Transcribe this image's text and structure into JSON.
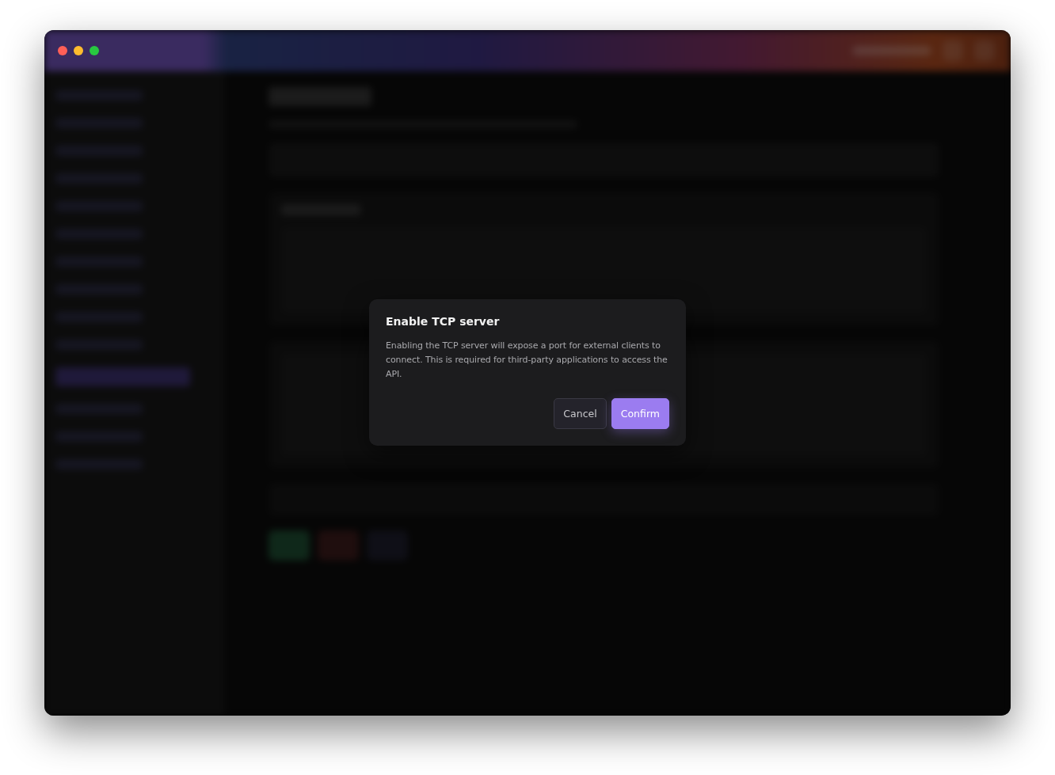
{
  "sidebar": {
    "items": [
      {
        "selected": false
      },
      {
        "selected": false
      },
      {
        "selected": false
      },
      {
        "selected": false
      },
      {
        "selected": false
      },
      {
        "selected": false
      },
      {
        "selected": false
      },
      {
        "selected": false
      },
      {
        "selected": false
      },
      {
        "selected": false
      },
      {
        "selected": true
      },
      {
        "selected": false
      },
      {
        "selected": false
      },
      {
        "selected": false
      }
    ]
  },
  "dialog": {
    "title": "Enable TCP server",
    "message": "Enabling the TCP server will expose a port for external clients to connect. This is required for third-party applications to access the API.",
    "buttons": [
      {
        "label": "Cancel",
        "kind": "secondary"
      },
      {
        "label": "Confirm",
        "kind": "primary"
      }
    ]
  }
}
